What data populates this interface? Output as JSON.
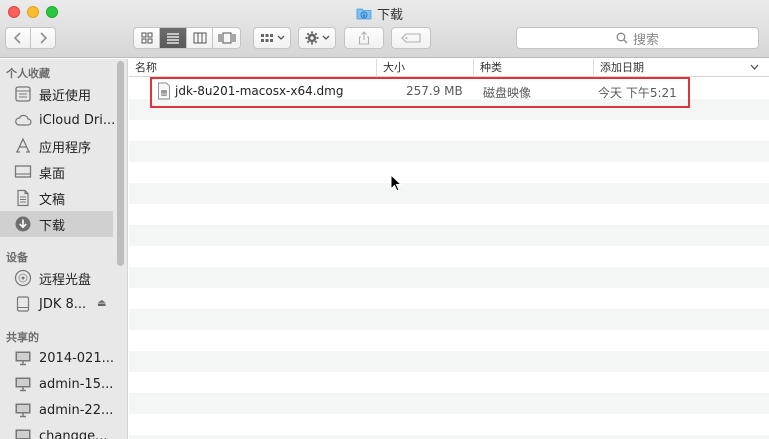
{
  "window": {
    "title": "下载"
  },
  "toolbar": {
    "back_icon": "chevron-left-icon",
    "forward_icon": "chevron-right-icon",
    "views": [
      "icon-view",
      "list-view",
      "column-view",
      "coverflow-view"
    ],
    "active_view": "list-view",
    "search_placeholder": "搜索"
  },
  "sidebar": {
    "favorites_title": "个人收藏",
    "favorites": [
      {
        "label": "最近使用",
        "icon": "recents-icon"
      },
      {
        "label": "iCloud Dri...",
        "icon": "icloud-icon"
      },
      {
        "label": "应用程序",
        "icon": "applications-icon"
      },
      {
        "label": "桌面",
        "icon": "desktop-icon"
      },
      {
        "label": "文稿",
        "icon": "documents-icon"
      },
      {
        "label": "下载",
        "icon": "downloads-icon",
        "selected": true
      }
    ],
    "devices_title": "设备",
    "devices": [
      {
        "label": "远程光盘",
        "icon": "remote-disc-icon"
      },
      {
        "label": "JDK 8...",
        "icon": "disk-image-icon",
        "eject": "⏏"
      }
    ],
    "shared_title": "共享的",
    "shared": [
      {
        "label": "2014-021...",
        "icon": "computer-icon"
      },
      {
        "label": "admin-15...",
        "icon": "computer-icon"
      },
      {
        "label": "admin-22...",
        "icon": "computer-icon"
      },
      {
        "label": "changge...",
        "icon": "computer-icon"
      }
    ]
  },
  "table": {
    "columns": [
      "名称",
      "大小",
      "种类",
      "添加日期"
    ],
    "rows": [
      {
        "name": "jdk-8u201-macosx-x64.dmg",
        "size": "257.9 MB",
        "kind": "磁盘映像",
        "date": "今天 下午5:21"
      }
    ]
  },
  "colors": {
    "highlight": "#e0323a",
    "selected_sidebar": "#d0d0d0"
  }
}
